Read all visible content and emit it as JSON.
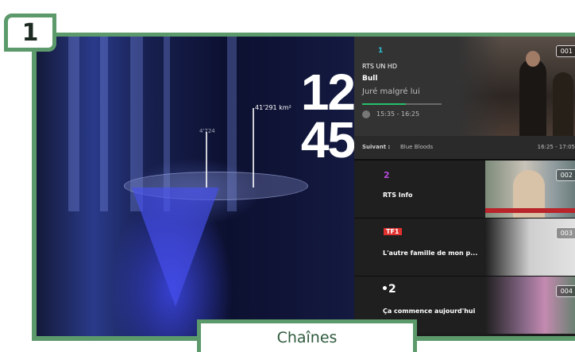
{
  "step": {
    "number": "1"
  },
  "caption": {
    "label": "Chaînes"
  },
  "live_view": {
    "clock_hours": "12",
    "clock_minutes": "45",
    "distance_label": "41'291 km²",
    "small_label": "4'724"
  },
  "current_program": {
    "channel_name": "RTS UN HD",
    "channel_logo": "1",
    "show_title": "Bull",
    "episode_title": "Juré malgré lui",
    "time_range": "15:35 - 16:25",
    "progress_fraction": 0.55,
    "channel_number": "001"
  },
  "next_program": {
    "label": "Suivant :",
    "show_title": "Blue Bloods",
    "time_range": "16:25 - 17:05"
  },
  "channels": [
    {
      "number": "002",
      "logo": "2",
      "title": "RTS Info",
      "accent": "#b44bd6"
    },
    {
      "number": "003",
      "logo": "TF1",
      "title": "L'autre famille de mon p...",
      "accent": "#e0312e"
    },
    {
      "number": "004",
      "logo": "•2",
      "title": "Ça commence aujourd'hui",
      "accent": "#e0312e"
    }
  ],
  "rail": {
    "icons": [
      "star-icon",
      "list-icon"
    ]
  },
  "colors": {
    "frame": "#5c9a6c",
    "progress": "#25c06a"
  }
}
